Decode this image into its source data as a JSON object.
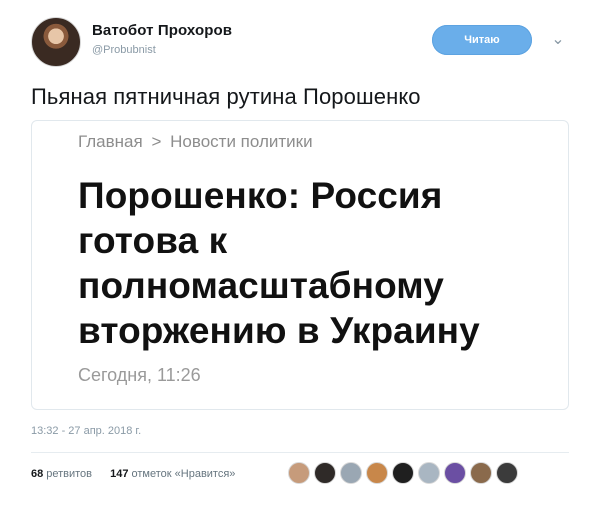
{
  "user": {
    "name": "Ватобот Прохоров",
    "handle": "@Probubnist",
    "follow_label": "Читаю"
  },
  "tweet": {
    "text": "Пьяная пятничная рутина Порошенко",
    "datetime": "13:32 - 27 апр. 2018 г."
  },
  "card": {
    "breadcrumb_home": "Главная",
    "breadcrumb_separator": ">",
    "breadcrumb_section": "Новости политики",
    "headline_lines": [
      "Порошенко: Россия",
      "готова к",
      "полномасштабному",
      "вторжению в Украину"
    ],
    "timestamp": "Сегодня, 11:26"
  },
  "stats": {
    "retweets_count": "68",
    "retweets_label": "ретвитов",
    "likes_count": "147",
    "likes_label": "отметок «Нравится»"
  },
  "likers": [
    {
      "name": "liker-avatar-1",
      "color": "#c69b7b"
    },
    {
      "name": "liker-avatar-2",
      "color": "#2f2a28"
    },
    {
      "name": "liker-avatar-3",
      "color": "#9aa7b3"
    },
    {
      "name": "liker-avatar-4",
      "color": "#c8874a"
    },
    {
      "name": "liker-avatar-5",
      "color": "#1f1f1f"
    },
    {
      "name": "liker-avatar-6",
      "color": "#a9b6c2"
    },
    {
      "name": "liker-avatar-7",
      "color": "#6b4fa3"
    },
    {
      "name": "liker-avatar-8",
      "color": "#8a6a4c"
    },
    {
      "name": "liker-avatar-9",
      "color": "#3b3b3b"
    }
  ],
  "colors": {
    "follow_button": "#6aaeea",
    "muted_text": "#8a9aa6",
    "card_border": "#e1e8ed"
  },
  "icons": {
    "caret": "chevron-down-icon"
  }
}
